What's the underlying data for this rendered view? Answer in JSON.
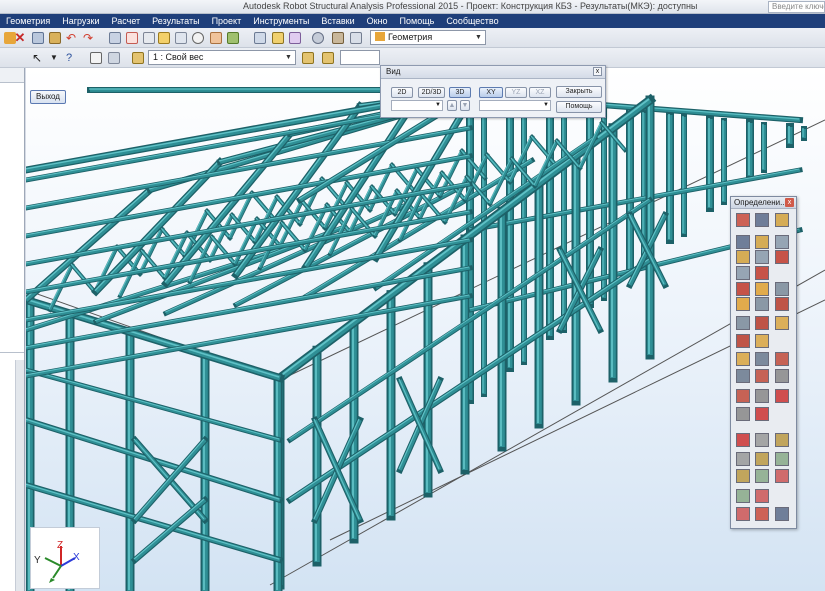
{
  "window": {
    "title": "Autodesk Robot Structural Analysis Professional 2015 - Проект: Конструкция КБЗ - Результаты(МКЭ): доступны",
    "search_placeholder": "Введите ключевое"
  },
  "menu": [
    "Геометрия",
    "Нагрузки",
    "Расчет",
    "Результаты",
    "Проект",
    "Инструменты",
    "Вставки",
    "Окно",
    "Помощь",
    "Сообщество"
  ],
  "toolbar": {
    "layout_combo": "Геометрия",
    "load_case_combo": "1 : Свой вес"
  },
  "exit_button": "Выход",
  "view_dialog": {
    "title": "Вид",
    "close_x": "x",
    "mode_buttons": [
      "2D",
      "2D/3D",
      "3D"
    ],
    "plane_buttons": [
      "XY",
      "YZ",
      "XZ"
    ],
    "close_button": "Закрыть",
    "help_button": "Помощь"
  },
  "definitions_palette": {
    "title": "Определени...",
    "close_x": "x"
  },
  "axes": {
    "x": "X",
    "y": "Y",
    "z": "Z"
  },
  "colors": {
    "member": "#2f8f95",
    "member_light": "#5fc1c6",
    "member_dark": "#1d6168",
    "menubar": "#1f3f7a"
  }
}
